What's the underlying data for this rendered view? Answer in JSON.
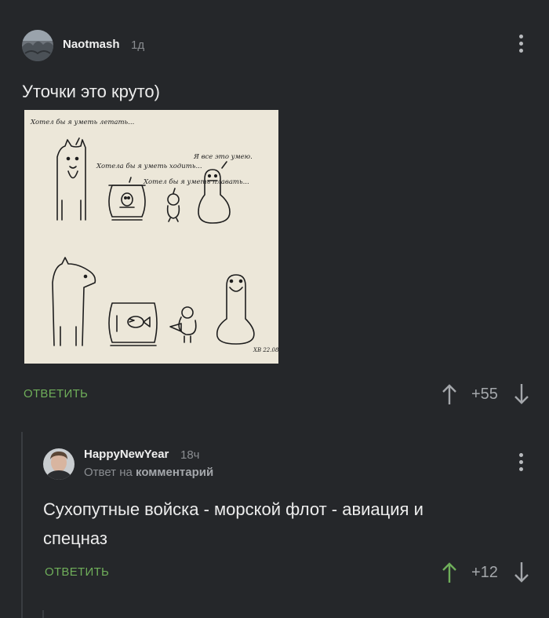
{
  "comment1": {
    "username": "Naotmash",
    "time": "1д",
    "text": "Уточки это круто)",
    "image": {
      "panel1_dog_caption": "Хотел бы я уметь летать...",
      "panel1_fish_caption": "Хотела бы я уметь ходить...",
      "panel1_chick_caption": "Хотел бы я уметь плавать...",
      "panel1_duck_caption": "Я все это умею.",
      "signature": "ХВ 22.08.14"
    },
    "reply_label": "ОТВЕТИТЬ",
    "score": "+55"
  },
  "comment2": {
    "username": "HappyNewYear",
    "time": "18ч",
    "reply_to_prefix": "Ответ на",
    "reply_to_target": "комментарий",
    "text_line1": "Сухопутные войска - морской флот - авиация и",
    "text_line2": "спецназ",
    "reply_label": "ОТВЕТИТЬ",
    "score": "+12"
  },
  "colors": {
    "background": "#25272a",
    "reply_green": "#6fae5a",
    "upvote_active": "#6fae5a",
    "vote_inactive": "#a4a7ab"
  },
  "icons": {
    "upvote": "arrow-up-icon",
    "downvote": "arrow-down-icon",
    "menu": "more-vertical-icon"
  }
}
